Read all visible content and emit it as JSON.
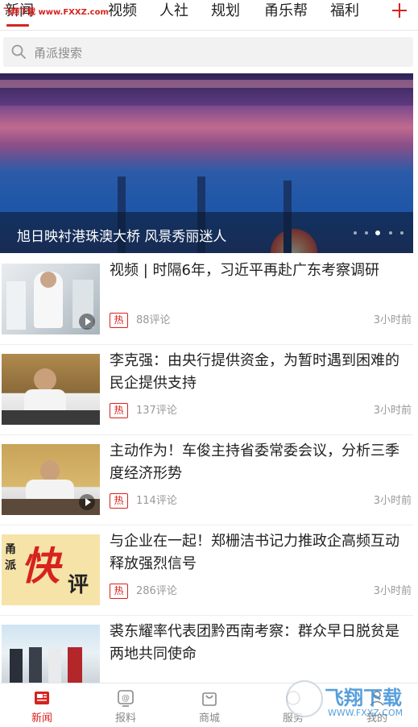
{
  "watermark_top": "飞翔下载 www.FXXZ.com",
  "tabs": [
    {
      "label": "新闻"
    },
    {
      "label": "视频"
    },
    {
      "label": "人社"
    },
    {
      "label": "规划"
    },
    {
      "label": "甬乐帮"
    },
    {
      "label": "福利"
    }
  ],
  "search": {
    "placeholder": "甬派搜索"
  },
  "banner": {
    "caption": "旭日映衬港珠澳大桥 风景秀丽迷人",
    "dots_total": 5,
    "dots_active": 3
  },
  "news": [
    {
      "title": "视频 | 时隔6年，习近平再赴广东考察调研",
      "badge": "热",
      "comments": "88评论",
      "time": "3小时前",
      "has_video": true
    },
    {
      "title": "李克强：由央行提供资金，为暂时遇到困难的民企提供支持",
      "badge": "热",
      "comments": "137评论",
      "time": "3小时前",
      "has_video": false
    },
    {
      "title": "主动作为！车俊主持省委常委会议，分析三季度经济形势",
      "badge": "热",
      "comments": "114评论",
      "time": "3小时前",
      "has_video": true
    },
    {
      "title": "与企业在一起！郑栅洁书记力推政企高频互动释放强烈信号",
      "badge": "热",
      "comments": "286评论",
      "time": "3小时前",
      "has_video": false
    },
    {
      "title": "裘东耀率代表团黔西南考察：群众早日脱贫是两地共同使命",
      "badge": "",
      "comments": "",
      "time": "",
      "has_video": false
    }
  ],
  "thumb_text": {
    "label1": "甬",
    "label2": "派",
    "big": "快",
    "small": "评"
  },
  "bottom_nav": [
    {
      "label": "新闻",
      "icon": "newspaper-icon",
      "active": true
    },
    {
      "label": "报料",
      "icon": "report-icon",
      "active": false
    },
    {
      "label": "商城",
      "icon": "shopping-bag-icon",
      "active": false
    },
    {
      "label": "服务",
      "icon": "service-icon",
      "active": false
    },
    {
      "label": "我的",
      "icon": "profile-icon",
      "active": false
    }
  ],
  "corner_watermark": {
    "line1": "飞翔下载",
    "line2": "WWW.FXXZ.COM"
  },
  "colors": {
    "accent": "#d6231f",
    "muted": "#999999",
    "search_bg": "#f2f2f2"
  }
}
